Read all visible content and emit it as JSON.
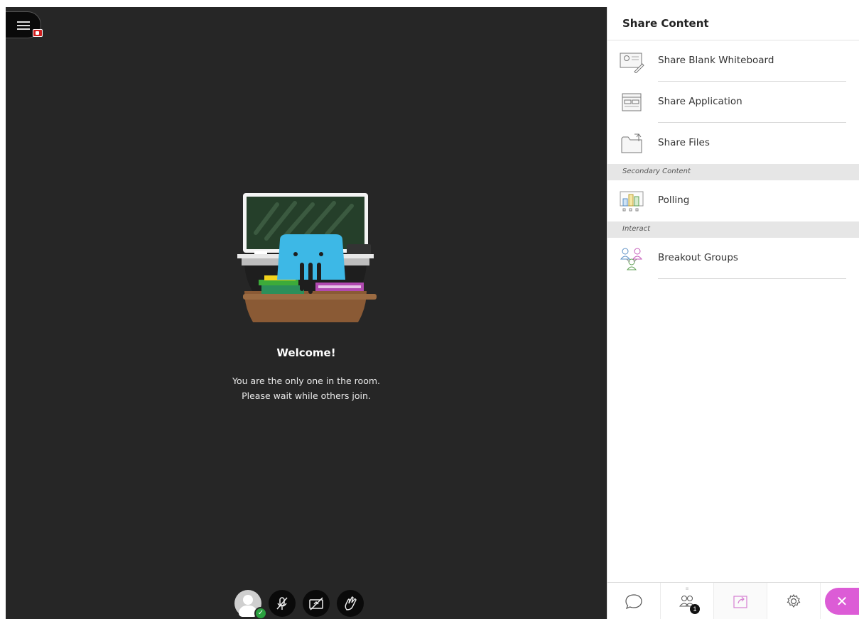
{
  "stage": {
    "welcome_title": "Welcome!",
    "welcome_line1": "You are the only one in the room.",
    "welcome_line2": "Please wait while others join."
  },
  "controls": [
    {
      "name": "profile",
      "icon": "avatar-icon",
      "status": "check-icon"
    },
    {
      "name": "microphone",
      "icon": "mic-off-icon"
    },
    {
      "name": "camera",
      "icon": "camera-off-icon"
    },
    {
      "name": "hand",
      "icon": "raise-hand-icon"
    }
  ],
  "panel": {
    "title": "Share Content",
    "items": [
      {
        "label": "Share Blank Whiteboard",
        "icon": "whiteboard-icon"
      },
      {
        "label": "Share Application",
        "icon": "application-icon"
      },
      {
        "label": "Share Files",
        "icon": "files-icon"
      }
    ],
    "sections": [
      {
        "label": "Secondary Content",
        "items": [
          {
            "label": "Polling",
            "icon": "polling-icon"
          }
        ]
      },
      {
        "label": "Interact",
        "items": [
          {
            "label": "Breakout Groups",
            "icon": "breakout-groups-icon"
          }
        ]
      }
    ]
  },
  "tabbar": {
    "tabs": [
      {
        "icon": "chat-icon"
      },
      {
        "icon": "attendees-icon",
        "badge": "1"
      },
      {
        "icon": "share-content-icon",
        "active": true
      },
      {
        "icon": "settings-icon"
      }
    ],
    "close_icon": "close-icon"
  },
  "colors": {
    "stage_bg": "#262626",
    "accent": "#dc5cd6",
    "status_green": "#2aa13f",
    "record_red": "#d01f1f"
  }
}
